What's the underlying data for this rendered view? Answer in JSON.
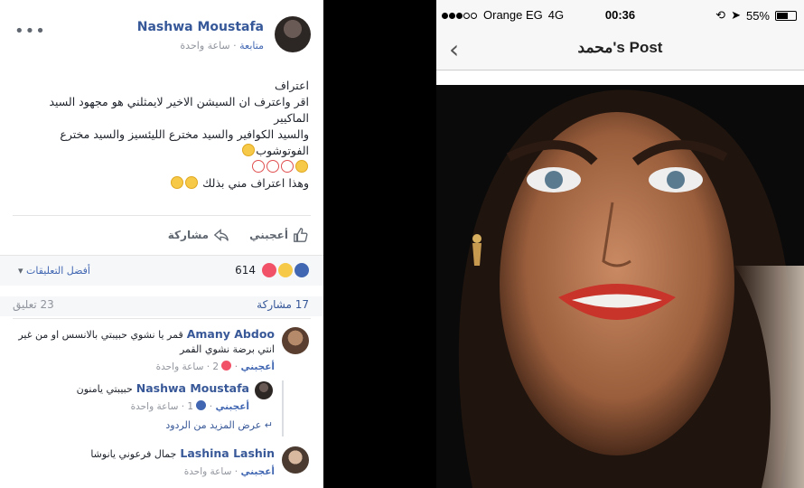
{
  "post": {
    "author": "Nashwa Moustafa",
    "time": "ساعة واحدة",
    "follow": "متابعة",
    "more": "•••",
    "text_lines": [
      "اعتراف",
      "اقر واعترف ان السيشن الاخير لايمثلني هو مجهود السيد الماكيير",
      "والسيد الكوافير والسيد مخترع الليئسيز والسيد مخترع الفوتوشوب",
      "وهذا اعتراف مني بذلك"
    ]
  },
  "actions": {
    "like": "أعجبني",
    "share": "مشاركة"
  },
  "reactions": {
    "count": "614",
    "sort": "أفضل التعليقات",
    "icons": [
      "like",
      "haha",
      "love"
    ]
  },
  "stats": {
    "shares": "17 مشاركة",
    "comments": "23 تعليق"
  },
  "comments": [
    {
      "name": "Amany Abdoo",
      "text_line1": "قمر يا نشوي حبيبتي بالانسس او من غير",
      "text_line2": "انتي برضة نشوي القمر",
      "like": "أعجبني",
      "reacts": "2",
      "time": "ساعة واحدة"
    },
    {
      "name": "Nashwa Moustafa",
      "text": "حبيبتي يامنون",
      "like": "أعجبني",
      "reacts": "1",
      "time": "ساعة واحدة"
    },
    {
      "name": "Lashina Lashin",
      "text": "جمال فرعوني يانوشا",
      "like": "أعجبني",
      "time": "ساعة واحدة"
    }
  ],
  "more_replies": "عرض المزيد من الردود",
  "phone": {
    "carrier": "Orange EG",
    "network": "4G",
    "time": "00:36",
    "battery": "55%",
    "title": "محمد's Post",
    "back": "‹"
  }
}
